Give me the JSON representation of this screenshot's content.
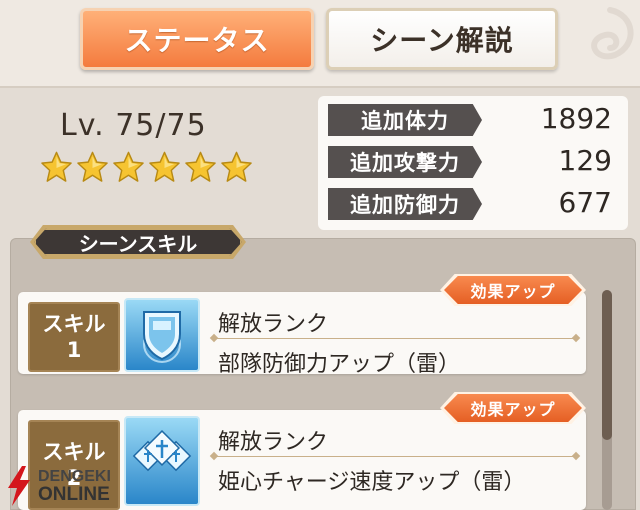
{
  "tabs": {
    "status_label": "ステータス",
    "scene_label": "シーン解説"
  },
  "level": {
    "text": "Lv. 75/75"
  },
  "rarity": {
    "stars": 6,
    "color": "#f6c431"
  },
  "stats": [
    {
      "label": "追加体力",
      "value": "1892"
    },
    {
      "label": "追加攻撃力",
      "value": "129"
    },
    {
      "label": "追加防御力",
      "value": "677"
    }
  ],
  "scene_skill": {
    "header": "シーンスキル",
    "skills": [
      {
        "tag_line1": "スキル",
        "tag_line2": "1",
        "icon": "shield-icon",
        "line1": "解放ランク",
        "line2": "部隊防御力アップ（雷）",
        "badge": "効果アップ"
      },
      {
        "tag_line1": "スキル",
        "tag_line2": "2",
        "icon": "crystal-cross-icon",
        "line1": "解放ランク",
        "line2": "姫心チャージ速度アップ（雷）",
        "badge": "効果アップ"
      }
    ]
  },
  "watermark": {
    "line1": "DENGEKI",
    "line2": "ONLINE"
  },
  "colors": {
    "accent_orange": "#f47b3e",
    "label_dark": "#55504f",
    "skill_tag_brown": "#8b6b3d"
  }
}
